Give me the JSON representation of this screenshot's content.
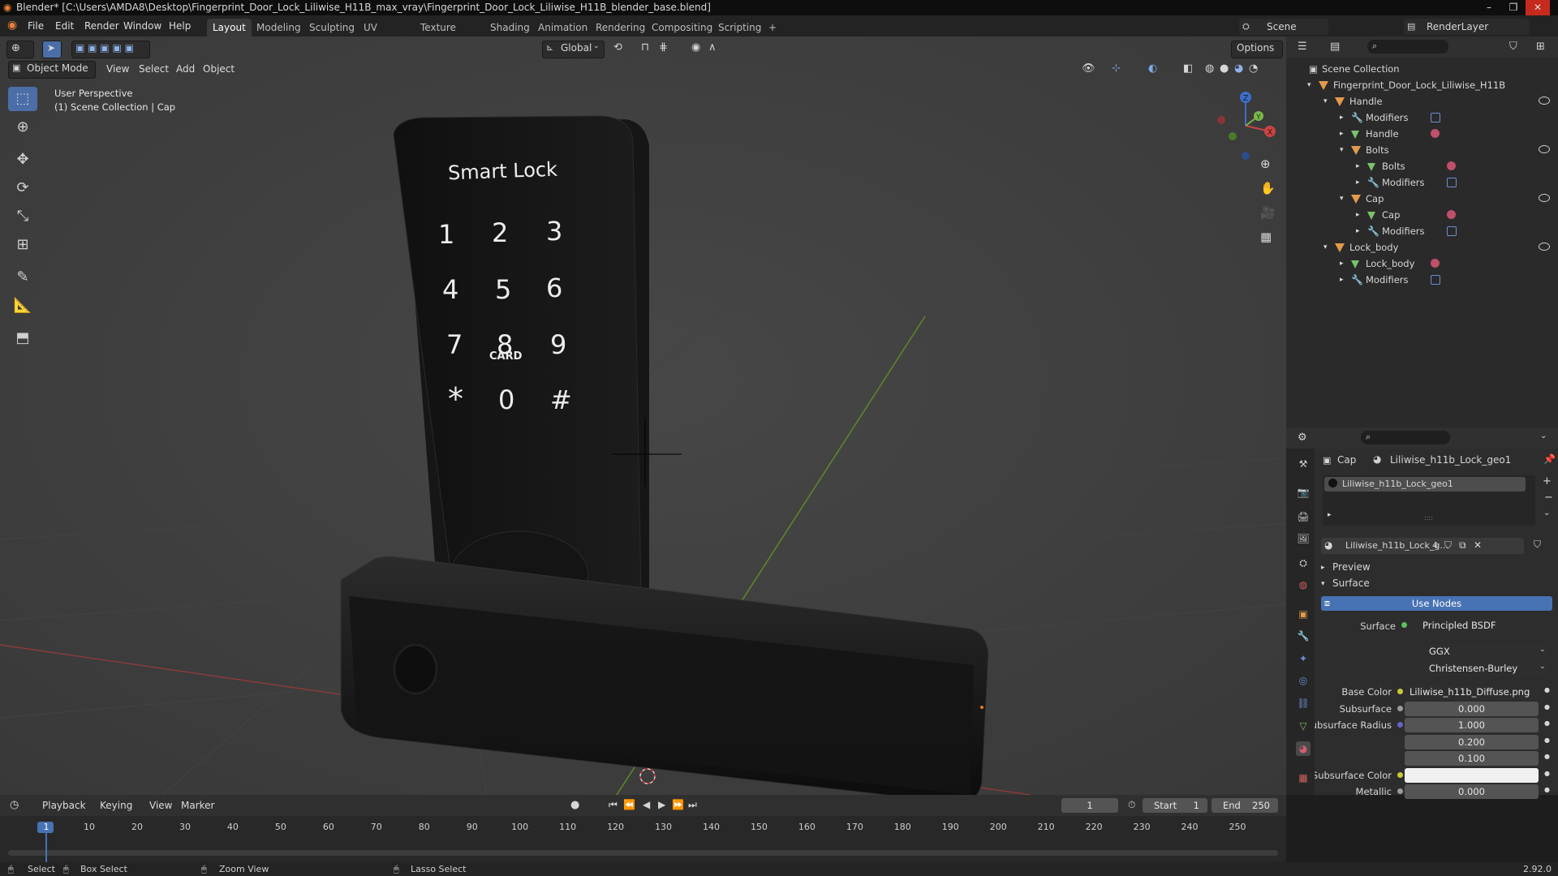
{
  "title_bar": {
    "text": "Blender* [C:\\Users\\AMDA8\\Desktop\\Fingerprint_Door_Lock_Liliwise_H11B_max_vray\\Fingerprint_Door_Lock_Liliwise_H11B_blender_base.blend]",
    "min": "–",
    "max": "❐",
    "close": "✕"
  },
  "menu": [
    "File",
    "Edit",
    "Render",
    "Window",
    "Help"
  ],
  "workspaces": [
    "Layout",
    "Modeling",
    "Sculpting",
    "UV Editing",
    "Texture Paint",
    "Shading",
    "Animation",
    "Rendering",
    "Compositing",
    "Scripting",
    "+"
  ],
  "scene": {
    "label": "Scene",
    "renderlayer": "RenderLayer"
  },
  "viewport_header": {
    "mode": "Object Mode",
    "items": [
      "View",
      "Select",
      "Add",
      "Object"
    ],
    "orientation": "Global",
    "options": "Options"
  },
  "viewport_overlay": {
    "perspective": "User Perspective",
    "collection": "(1) Scene Collection | Cap"
  },
  "lock_model": {
    "brand": "Smart Lock",
    "keys": [
      "1",
      "2",
      "3",
      "4",
      "5",
      "6",
      "7",
      "8",
      "9",
      "*",
      "0",
      "#"
    ],
    "card_label": "CARD"
  },
  "gizmo": {
    "x": "X",
    "y": "Y",
    "z": "Z"
  },
  "outliner": {
    "root": "Scene Collection",
    "rows": [
      {
        "label": "Fingerprint_Door_Lock_Liliwise_H11B",
        "icon": "collection-icon",
        "indent": 1
      },
      {
        "label": "Handle",
        "icon": "object-icon",
        "indent": 2
      },
      {
        "label": "Modifiers",
        "icon": "wrench-icon",
        "indent": 3
      },
      {
        "label": "Handle",
        "icon": "mesh-icon",
        "indent": 3
      },
      {
        "label": "Bolts",
        "icon": "object-icon",
        "indent": 3
      },
      {
        "label": "Bolts",
        "icon": "mesh-icon",
        "indent": 4
      },
      {
        "label": "Modifiers",
        "icon": "wrench-icon",
        "indent": 4
      },
      {
        "label": "Cap",
        "icon": "object-icon",
        "indent": 3
      },
      {
        "label": "Cap",
        "icon": "mesh-icon",
        "indent": 4
      },
      {
        "label": "Modifiers",
        "icon": "wrench-icon",
        "indent": 4
      },
      {
        "label": "Lock_body",
        "icon": "object-icon",
        "indent": 2
      },
      {
        "label": "Lock_body",
        "icon": "mesh-icon",
        "indent": 3
      },
      {
        "label": "Modifiers",
        "icon": "wrench-icon",
        "indent": 3
      }
    ]
  },
  "properties": {
    "object": "Cap",
    "material": "Liliwise_h11b_Lock_geo1",
    "slot": "Liliwise_h11b_Lock_geo1",
    "datablock": "Liliwise_h11b_Lock_g...",
    "users": "4",
    "preview": "Preview",
    "surface_panel": "Surface",
    "use_nodes": "Use Nodes",
    "surface_label": "Surface",
    "surface_value": "Principled BSDF",
    "distribution": "GGX",
    "subsurface_method": "Christensen-Burley",
    "fields": [
      {
        "label": "Base Color",
        "value": "Liliwise_h11b_Diffuse.png",
        "kind": "texture"
      },
      {
        "label": "Subsurface",
        "value": "0.000",
        "kind": "number"
      },
      {
        "label": "Subsurface Radius",
        "value": "1.000",
        "kind": "vector"
      },
      {
        "label": "",
        "value": "0.200",
        "kind": "vector"
      },
      {
        "label": "",
        "value": "0.100",
        "kind": "vector"
      },
      {
        "label": "Subsurface Color",
        "value": "",
        "kind": "color"
      },
      {
        "label": "Metallic",
        "value": "0.000",
        "kind": "number"
      }
    ]
  },
  "timeline": {
    "menus": [
      "Playback",
      "Keying",
      "View",
      "Marker"
    ],
    "current_frame": "1",
    "start_label": "Start",
    "start": "1",
    "end_label": "End",
    "end": "250",
    "ticks": [
      "1",
      "10",
      "20",
      "30",
      "40",
      "50",
      "60",
      "70",
      "80",
      "90",
      "100",
      "110",
      "120",
      "130",
      "140",
      "150",
      "160",
      "170",
      "180",
      "190",
      "200",
      "210",
      "220",
      "230",
      "240",
      "250"
    ]
  },
  "status": {
    "select": "Select",
    "box_select": "Box Select",
    "zoom_view": "Zoom View",
    "lasso_select": "Lasso Select",
    "version": "2.92.0"
  }
}
